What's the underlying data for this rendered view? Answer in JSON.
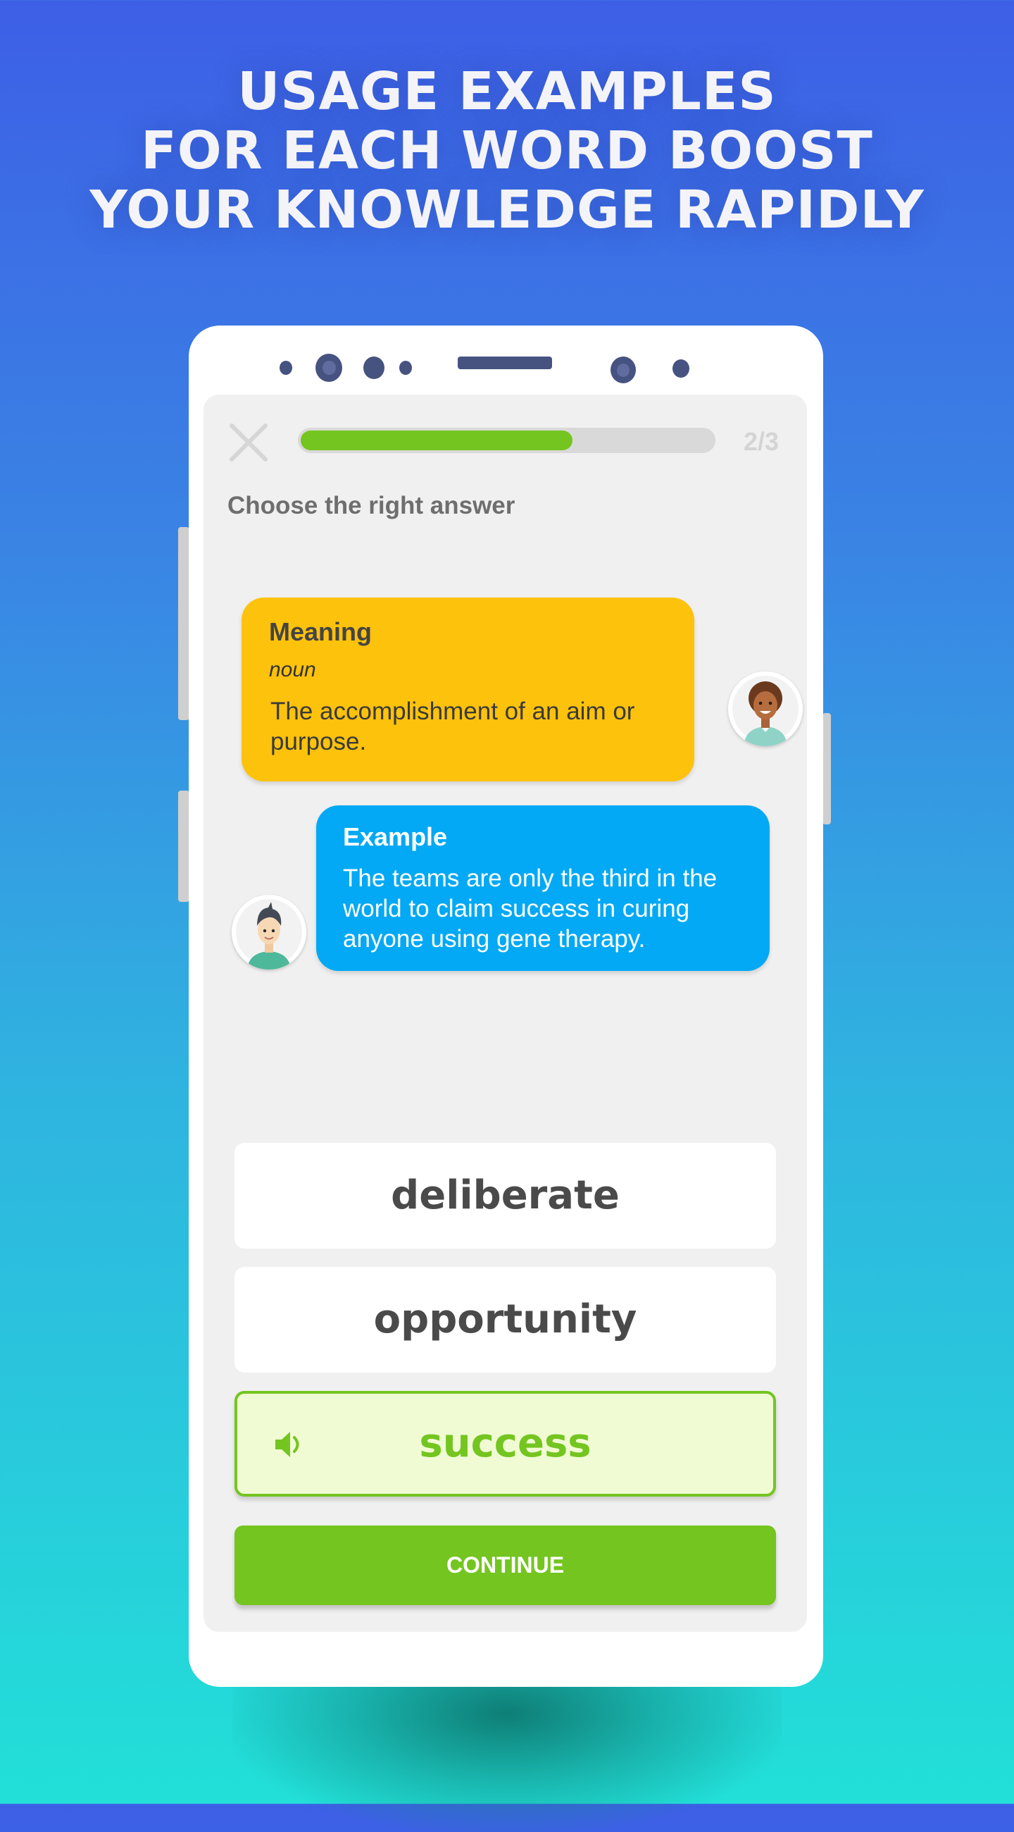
{
  "headline": {
    "lines": [
      "USAGE EXAMPLES",
      "FOR EACH WORD BOOST",
      "YOUR KNOWLEDGE RAPIDLY"
    ]
  },
  "quiz": {
    "close_icon": "close-icon",
    "progress_fraction": 0.66,
    "counter": "2/3",
    "prompt": "Choose the right answer",
    "meaning": {
      "title": "Meaning",
      "part_of_speech": "noun",
      "text": "The accomplishment of an aim or purpose.",
      "avatar": "curly-hair-man-avatar"
    },
    "example": {
      "title": "Example",
      "text": "The teams are only the third in the world to claim success in curing anyone using gene therapy.",
      "avatar": "spiky-hair-man-avatar"
    },
    "options": [
      {
        "label": "deliberate",
        "selected": false
      },
      {
        "label": "opportunity",
        "selected": false
      },
      {
        "label": "success",
        "selected": true,
        "icon": "speaker-icon"
      }
    ],
    "continue_label": "CONTINUE"
  },
  "colors": {
    "accent_green": "#74c520",
    "meaning_yellow": "#fdc20c",
    "example_blue": "#03a9f4",
    "selected_bg": "#f0fbd4",
    "device_dark": "#465381"
  }
}
